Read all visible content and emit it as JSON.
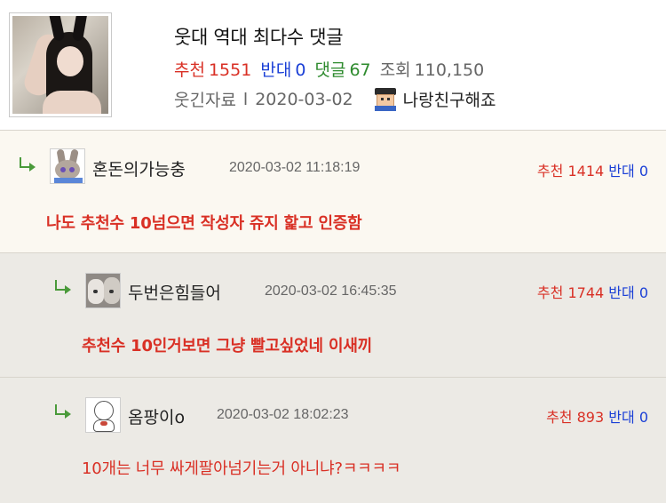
{
  "post": {
    "title": "웃대 역대 최다수 댓글",
    "stats": {
      "recommend_label": "추천",
      "recommend_count": "1551",
      "oppose_label": "반대",
      "oppose_count": "0",
      "comment_label": "댓글",
      "comment_count": "67",
      "views_label": "조회",
      "views_count": "110,150"
    },
    "meta": {
      "category": "웃긴자료",
      "separator": "l",
      "date": "2020-03-02",
      "author": "나랑친구해죠",
      "author_level_icon": "pixel-character-icon"
    },
    "thumbnail_icon": "post-thumbnail-image"
  },
  "comments": [
    {
      "nickname": "혼돈의가능충",
      "timestamp": "2020-03-02 11:18:19",
      "recommend_label": "추천",
      "recommend_count": "1414",
      "oppose_label": "반대",
      "oppose_count": "0",
      "text": "나도 추천수 10넘으면 작성자 쥬지 핥고 인증함",
      "avatar_icon": "rabbit-avatar-icon"
    },
    {
      "nickname": "두번은힘들어",
      "timestamp": "2020-03-02 16:45:35",
      "recommend_label": "추천",
      "recommend_count": "1744",
      "oppose_label": "반대",
      "oppose_count": "0",
      "text": "추천수 10인거보면 그냥 빨고싶었네 이새끼",
      "avatar_icon": "dogs-avatar-icon"
    },
    {
      "nickname": "옴팡이o",
      "timestamp": "2020-03-02 18:02:23",
      "recommend_label": "추천",
      "recommend_count": "893",
      "oppose_label": "반대",
      "oppose_count": "0",
      "text": "10개는 너무 싸게팔아넘기는거 아니냐?ㅋㅋㅋㅋ",
      "avatar_icon": "doll-avatar-icon"
    }
  ],
  "colors": {
    "recommend": "#d93025",
    "oppose": "#1a3fd6",
    "comment_count": "#2e8b2e",
    "reply_arrow": "#4a9a3a",
    "best_comment_bg": "#fbf8f1",
    "reply_bg": "#eceae5"
  }
}
